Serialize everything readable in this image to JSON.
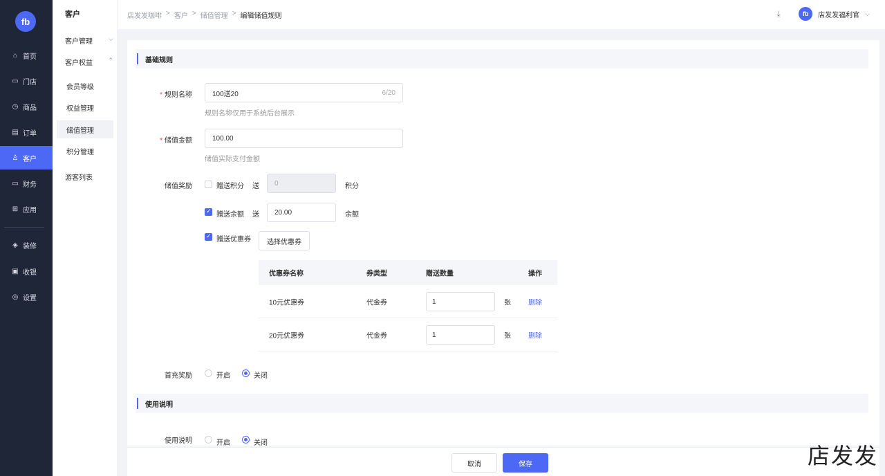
{
  "nav": {
    "logo_text": "fb",
    "items": [
      {
        "label": "首页",
        "icon": "⌂"
      },
      {
        "label": "门店",
        "icon": "▭"
      },
      {
        "label": "商品",
        "icon": "◷"
      },
      {
        "label": "订单",
        "icon": "▤"
      },
      {
        "label": "客户",
        "icon": "♙"
      },
      {
        "label": "财务",
        "icon": "▭"
      },
      {
        "label": "应用",
        "icon": "⊞"
      },
      {
        "label": "装修",
        "icon": "◈"
      },
      {
        "label": "收银",
        "icon": "▣"
      },
      {
        "label": "设置",
        "icon": "◎"
      }
    ]
  },
  "subnav": {
    "title": "客户",
    "group1": "客户管理",
    "group2": "客户权益",
    "items": [
      "会员等级",
      "权益管理",
      "储值管理",
      "积分管理"
    ],
    "group3": "游客列表"
  },
  "header": {
    "breadcrumb": [
      "店发发咖啡",
      ">",
      "客户",
      ">",
      "储值管理",
      ">",
      "编辑储值规则"
    ],
    "user": "店发发福利官",
    "avatar_text": "fb"
  },
  "form": {
    "section1": "基础规则",
    "rule_name_label": "规则名称",
    "rule_name_value": "100送20",
    "rule_name_count": "6/20",
    "rule_name_hint": "规则名称仅用于系统后台展示",
    "amount_label": "储值金额",
    "amount_value": "100.00",
    "amount_hint": "储值实际支付金额",
    "reward_label": "储值奖励",
    "points": {
      "label": "赠送积分",
      "send": "送",
      "value": "0",
      "unit": "积分"
    },
    "balance": {
      "label": "赠送余额",
      "send": "送",
      "value": "20.00",
      "unit": "余额"
    },
    "coupon": {
      "label": "赠送优惠券",
      "button": "选择优惠券"
    },
    "table": {
      "headers": [
        "优惠券名称",
        "券类型",
        "赠送数量",
        "操作"
      ],
      "rows": [
        {
          "name": "10元优惠券",
          "type": "代金券",
          "qty": "1",
          "unit": "张",
          "action": "删除"
        },
        {
          "name": "20元优惠券",
          "type": "代金券",
          "qty": "1",
          "unit": "张",
          "action": "删除"
        }
      ]
    },
    "first_label": "首充奖励",
    "on": "开启",
    "off": "关闭",
    "section2": "使用说明",
    "usage_label": "使用说明"
  },
  "footer": {
    "cancel": "取消",
    "save": "保存"
  },
  "watermark": "店发发",
  "colors": {
    "accent": "#4d68f5",
    "nav_bg": "#1f2637",
    "required": "#e5484d"
  }
}
